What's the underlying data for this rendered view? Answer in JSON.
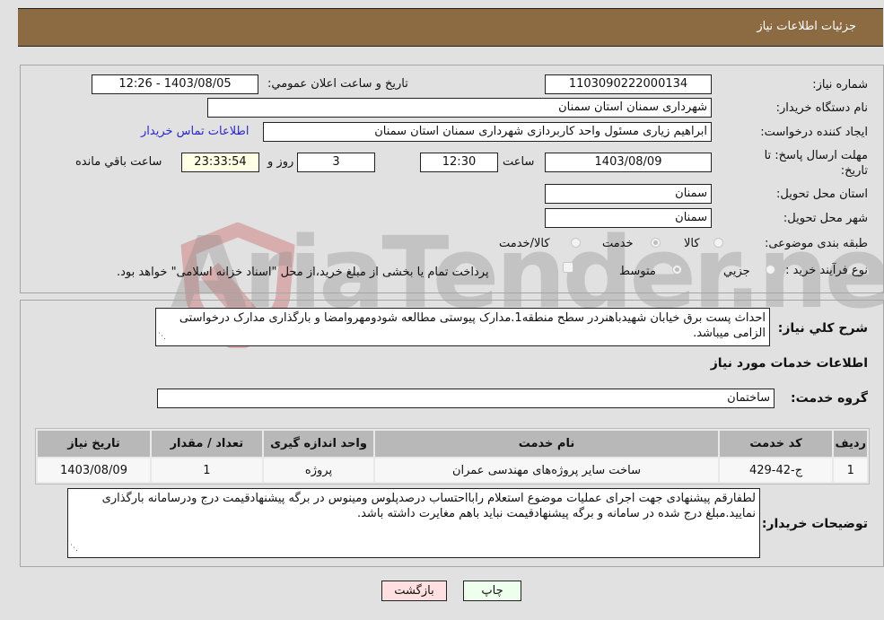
{
  "header": {
    "title": "جزئیات اطلاعات نیاز"
  },
  "fields": {
    "need_number_label": "شماره نیاز:",
    "need_number": "1103090222000134",
    "announce_label": "تاریخ و ساعت اعلان عمومي:",
    "announce_value": "1403/08/05 - 12:26",
    "buyer_org_label": "نام دستگاه خریدار:",
    "buyer_org": "شهرداری سمنان استان سمنان",
    "creator_label": "ایجاد کننده درخواست:",
    "creator": "ابراهیم زیاری مسئول واحد کاربردازی شهرداری سمنان استان سمنان",
    "contact_link": "اطلاعات تماس خریدار",
    "deadline_label": "مهلت ارسال پاسخ: تا تاریخ:",
    "deadline_date": "1403/08/09",
    "time_label": "ساعت",
    "deadline_time": "12:30",
    "days_value": "3",
    "days_label": "روز و",
    "remaining_time": "23:33:54",
    "remaining_label": "ساعت باقي مانده",
    "province_label": "استان محل تحویل:",
    "province": "سمنان",
    "city_label": "شهر محل تحویل:",
    "city": "سمنان"
  },
  "category": {
    "label": "طبقه بندی موضوعی:",
    "options": [
      {
        "label": "کالا",
        "checked": false
      },
      {
        "label": "خدمت",
        "checked": true
      },
      {
        "label": "کالا/خدمت",
        "checked": false
      }
    ]
  },
  "process": {
    "label": "نوع فرآیند خرید :",
    "options": [
      {
        "label": "جزيي",
        "checked": false
      },
      {
        "label": "متوسط",
        "checked": true
      }
    ],
    "treasury_text": "پرداخت تمام یا بخشی از مبلغ خرید،از محل \"اسناد خزانه اسلامی\" خواهد بود."
  },
  "description": {
    "label": "شرح کلي نياز:",
    "text": "احداث پست برق خیابان شهیدباهنردر سطح منطقه1.مدارک پیوستی مطالعه شودومهروامضا و بارگذاری مدارک درخواستی الزامی میباشد."
  },
  "services": {
    "section_title": "اطلاعات خدمات مورد نیاز",
    "group_label": "گروه خدمت:",
    "group_value": "ساختمان",
    "table": {
      "headers": [
        "ردیف",
        "کد خدمت",
        "نام خدمت",
        "واحد اندازه گیری",
        "تعداد / مقدار",
        "تاریخ نیاز"
      ],
      "rows": [
        [
          "1",
          "ج-42-429",
          "ساخت سایر پروژه‌های مهندسی عمران",
          "پروژه",
          "1",
          "1403/08/09"
        ]
      ]
    }
  },
  "buyer_notes": {
    "label": "توضیحات خریدار:",
    "text": "لطفارقم پیشنهادی جهت اجرای عملیات موضوع استعلام رابااحتساب درصدپلوس ومینوس در برگه پیشنهادقیمت درج ودرسامانه بارگذاری نمایید.مبلغ درج شده در سامانه و برگه پیشنهادقیمت نباید باهم مغایرت داشته باشد."
  },
  "buttons": {
    "print": "چاپ",
    "back": "بازگشت"
  },
  "watermark": "AriaTender.neT",
  "colors": {
    "header_bg": "#8c6b42",
    "link": "#2a27c8",
    "print_bg": "#eeffee",
    "back_bg": "#ffe0e0"
  }
}
